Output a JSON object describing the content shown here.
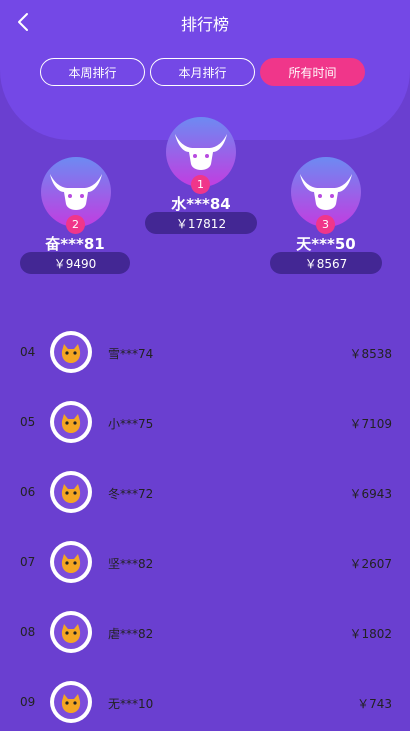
{
  "header": {
    "title": "排行榜"
  },
  "tabs": [
    {
      "label": "本周排行",
      "active": false
    },
    {
      "label": "本月排行",
      "active": false
    },
    {
      "label": "所有时间",
      "active": true
    }
  ],
  "podium": [
    {
      "rank": "1",
      "name": "水***84",
      "amount": "￥17812"
    },
    {
      "rank": "2",
      "name": "奋***81",
      "amount": "￥9490"
    },
    {
      "rank": "3",
      "name": "天***50",
      "amount": "￥8567"
    }
  ],
  "list": [
    {
      "rank": "04",
      "name": "雪***74",
      "amount": "￥8538"
    },
    {
      "rank": "05",
      "name": "小***75",
      "amount": "￥7109"
    },
    {
      "rank": "06",
      "name": "冬***72",
      "amount": "￥6943"
    },
    {
      "rank": "07",
      "name": "坚***82",
      "amount": "￥2607"
    },
    {
      "rank": "08",
      "name": "虐***82",
      "amount": "￥1802"
    },
    {
      "rank": "09",
      "name": "无***10",
      "amount": "￥743"
    }
  ],
  "colors": {
    "background": "#6a3fd0",
    "accent": "#f0368a",
    "amount_pill": "#432794"
  },
  "icons": {
    "back": "chevron-left-icon",
    "podium_avatar": "bull-head-icon",
    "list_avatar": "cartoon-cat-avatar"
  }
}
